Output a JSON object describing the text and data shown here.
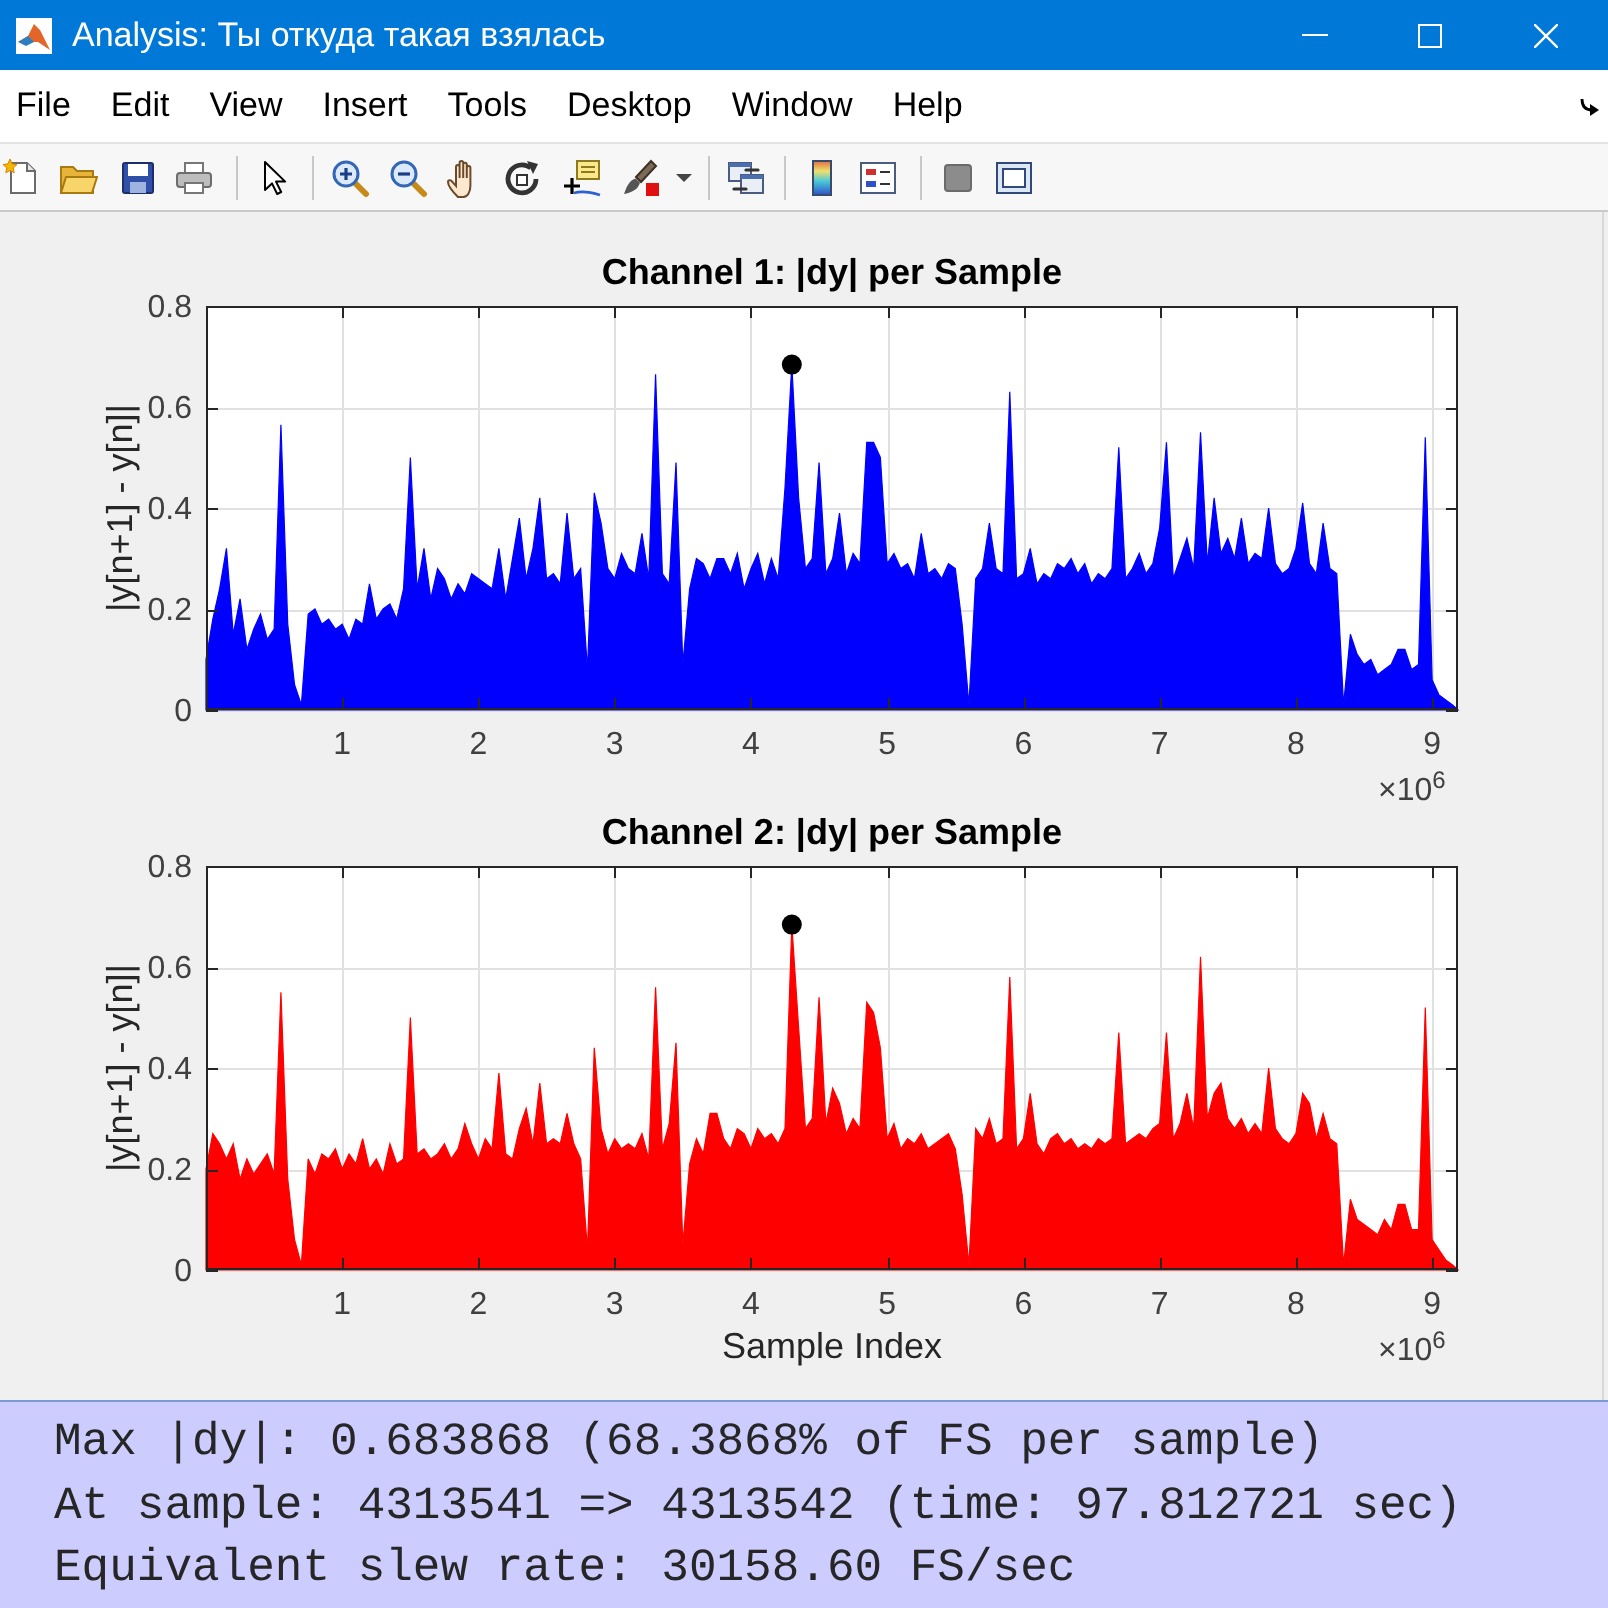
{
  "window": {
    "title": "Analysis: Ты откуда такая взялась"
  },
  "menu": [
    "File",
    "Edit",
    "View",
    "Insert",
    "Tools",
    "Desktop",
    "Window",
    "Help"
  ],
  "figure": {
    "axes": [
      {
        "x_exponent": "×10$^{6}$",
        "peak_marker": true,
        "chart_data": {
          "type": "area",
          "title": "Channel 1: |dy| per Sample",
          "ylabel": "|y[n+1] - y[n]|",
          "grid": true,
          "xlim": [
            0,
            9.19
          ],
          "ylim": [
            0,
            0.8
          ],
          "xticks": [
            1,
            2,
            3,
            4,
            5,
            6,
            7,
            8,
            9
          ],
          "yticks": [
            0,
            0.2,
            0.4,
            0.6,
            0.8
          ],
          "x": [
            0,
            0.05,
            0.1,
            0.15,
            0.2,
            0.25,
            0.3,
            0.35,
            0.4,
            0.45,
            0.5,
            0.55,
            0.6,
            0.65,
            0.7,
            0.75,
            0.8,
            0.85,
            0.9,
            0.95,
            1,
            1.05,
            1.1,
            1.15,
            1.2,
            1.25,
            1.3,
            1.35,
            1.4,
            1.45,
            1.5,
            1.55,
            1.6,
            1.65,
            1.7,
            1.75,
            1.8,
            1.85,
            1.9,
            1.95,
            2,
            2.05,
            2.1,
            2.15,
            2.2,
            2.25,
            2.3,
            2.35,
            2.4,
            2.45,
            2.5,
            2.55,
            2.6,
            2.65,
            2.7,
            2.75,
            2.8,
            2.85,
            2.9,
            2.95,
            3,
            3.05,
            3.1,
            3.15,
            3.2,
            3.25,
            3.3,
            3.35,
            3.4,
            3.45,
            3.5,
            3.55,
            3.6,
            3.65,
            3.7,
            3.75,
            3.8,
            3.85,
            3.9,
            3.95,
            4,
            4.05,
            4.1,
            4.15,
            4.2,
            4.25,
            4.3,
            4.35,
            4.4,
            4.45,
            4.5,
            4.55,
            4.6,
            4.65,
            4.7,
            4.75,
            4.8,
            4.85,
            4.9,
            4.95,
            5,
            5.05,
            5.1,
            5.15,
            5.2,
            5.25,
            5.3,
            5.35,
            5.4,
            5.45,
            5.5,
            5.55,
            5.6,
            5.65,
            5.7,
            5.75,
            5.8,
            5.85,
            5.9,
            5.95,
            6,
            6.05,
            6.1,
            6.15,
            6.2,
            6.25,
            6.3,
            6.35,
            6.4,
            6.45,
            6.5,
            6.55,
            6.6,
            6.65,
            6.7,
            6.75,
            6.8,
            6.85,
            6.9,
            6.95,
            7,
            7.05,
            7.1,
            7.15,
            7.2,
            7.25,
            7.3,
            7.35,
            7.4,
            7.45,
            7.5,
            7.55,
            7.6,
            7.65,
            7.7,
            7.75,
            7.8,
            7.85,
            7.9,
            7.95,
            8,
            8.05,
            8.1,
            8.15,
            8.2,
            8.25,
            8.3,
            8.35,
            8.4,
            8.45,
            8.5,
            8.55,
            8.6,
            8.65,
            8.7,
            8.75,
            8.8,
            8.85,
            8.9,
            8.95,
            9,
            9.05,
            9.1,
            9.15,
            9.19
          ],
          "series": [
            {
              "color": "#0000ff",
              "values": [
                0.1,
                0.18,
                0.24,
                0.32,
                0.15,
                0.22,
                0.12,
                0.16,
                0.19,
                0.14,
                0.16,
                0.565,
                0.17,
                0.05,
                0.01,
                0.19,
                0.2,
                0.17,
                0.18,
                0.16,
                0.17,
                0.14,
                0.18,
                0.17,
                0.25,
                0.18,
                0.2,
                0.21,
                0.18,
                0.24,
                0.5,
                0.24,
                0.32,
                0.22,
                0.28,
                0.26,
                0.22,
                0.25,
                0.23,
                0.27,
                0.26,
                0.25,
                0.24,
                0.32,
                0.22,
                0.3,
                0.38,
                0.26,
                0.32,
                0.42,
                0.26,
                0.27,
                0.25,
                0.39,
                0.26,
                0.28,
                0.08,
                0.43,
                0.37,
                0.28,
                0.26,
                0.31,
                0.28,
                0.27,
                0.35,
                0.26,
                0.665,
                0.27,
                0.25,
                0.49,
                0.09,
                0.24,
                0.3,
                0.29,
                0.26,
                0.3,
                0.3,
                0.27,
                0.31,
                0.24,
                0.28,
                0.31,
                0.25,
                0.3,
                0.26,
                0.44,
                0.684,
                0.42,
                0.28,
                0.3,
                0.49,
                0.27,
                0.3,
                0.39,
                0.27,
                0.31,
                0.29,
                0.53,
                0.53,
                0.5,
                0.29,
                0.31,
                0.28,
                0.29,
                0.26,
                0.35,
                0.27,
                0.28,
                0.26,
                0.29,
                0.28,
                0.17,
                0.01,
                0.26,
                0.28,
                0.37,
                0.28,
                0.27,
                0.63,
                0.26,
                0.27,
                0.32,
                0.25,
                0.27,
                0.26,
                0.29,
                0.28,
                0.3,
                0.27,
                0.29,
                0.25,
                0.27,
                0.26,
                0.28,
                0.52,
                0.26,
                0.28,
                0.31,
                0.27,
                0.29,
                0.36,
                0.53,
                0.26,
                0.3,
                0.34,
                0.28,
                0.55,
                0.29,
                0.42,
                0.31,
                0.34,
                0.3,
                0.38,
                0.29,
                0.31,
                0.3,
                0.4,
                0.29,
                0.27,
                0.28,
                0.32,
                0.41,
                0.29,
                0.27,
                0.37,
                0.28,
                0.27,
                0.01,
                0.15,
                0.11,
                0.09,
                0.1,
                0.07,
                0.08,
                0.09,
                0.12,
                0.12,
                0.08,
                0.09,
                0.54,
                0.06,
                0.03,
                0.02,
                0.01,
                0
              ]
            }
          ]
        }
      },
      {
        "x_exponent": "×10$^{6}$",
        "peak_marker": true,
        "chart_data": {
          "type": "area",
          "title": "Channel 2: |dy| per Sample",
          "xlabel": "Sample Index",
          "ylabel": "|y[n+1] - y[n]|",
          "grid": true,
          "xlim": [
            0,
            9.19
          ],
          "ylim": [
            0,
            0.8
          ],
          "xticks": [
            1,
            2,
            3,
            4,
            5,
            6,
            7,
            8,
            9
          ],
          "yticks": [
            0,
            0.2,
            0.4,
            0.6,
            0.8
          ],
          "x": [
            0,
            0.05,
            0.1,
            0.15,
            0.2,
            0.25,
            0.3,
            0.35,
            0.4,
            0.45,
            0.5,
            0.55,
            0.6,
            0.65,
            0.7,
            0.75,
            0.8,
            0.85,
            0.9,
            0.95,
            1,
            1.05,
            1.1,
            1.15,
            1.2,
            1.25,
            1.3,
            1.35,
            1.4,
            1.45,
            1.5,
            1.55,
            1.6,
            1.65,
            1.7,
            1.75,
            1.8,
            1.85,
            1.9,
            1.95,
            2,
            2.05,
            2.1,
            2.15,
            2.2,
            2.25,
            2.3,
            2.35,
            2.4,
            2.45,
            2.5,
            2.55,
            2.6,
            2.65,
            2.7,
            2.75,
            2.8,
            2.85,
            2.9,
            2.95,
            3,
            3.05,
            3.1,
            3.15,
            3.2,
            3.25,
            3.3,
            3.35,
            3.4,
            3.45,
            3.5,
            3.55,
            3.6,
            3.65,
            3.7,
            3.75,
            3.8,
            3.85,
            3.9,
            3.95,
            4,
            4.05,
            4.1,
            4.15,
            4.2,
            4.25,
            4.3,
            4.35,
            4.4,
            4.45,
            4.5,
            4.55,
            4.6,
            4.65,
            4.7,
            4.75,
            4.8,
            4.85,
            4.9,
            4.95,
            5,
            5.05,
            5.1,
            5.15,
            5.2,
            5.25,
            5.3,
            5.35,
            5.4,
            5.45,
            5.5,
            5.55,
            5.6,
            5.65,
            5.7,
            5.75,
            5.8,
            5.85,
            5.9,
            5.95,
            6,
            6.05,
            6.1,
            6.15,
            6.2,
            6.25,
            6.3,
            6.35,
            6.4,
            6.45,
            6.5,
            6.55,
            6.6,
            6.65,
            6.7,
            6.75,
            6.8,
            6.85,
            6.9,
            6.95,
            7,
            7.05,
            7.1,
            7.15,
            7.2,
            7.25,
            7.3,
            7.35,
            7.4,
            7.45,
            7.5,
            7.55,
            7.6,
            7.65,
            7.7,
            7.75,
            7.8,
            7.85,
            7.9,
            7.95,
            8,
            8.05,
            8.1,
            8.15,
            8.2,
            8.25,
            8.3,
            8.35,
            8.4,
            8.45,
            8.5,
            8.55,
            8.6,
            8.65,
            8.7,
            8.75,
            8.8,
            8.85,
            8.9,
            8.95,
            9,
            9.05,
            9.1,
            9.15,
            9.19
          ],
          "series": [
            {
              "color": "#ff0000",
              "values": [
                0.2,
                0.27,
                0.25,
                0.22,
                0.25,
                0.18,
                0.22,
                0.19,
                0.21,
                0.23,
                0.19,
                0.55,
                0.18,
                0.06,
                0.01,
                0.22,
                0.19,
                0.23,
                0.22,
                0.24,
                0.2,
                0.23,
                0.21,
                0.26,
                0.2,
                0.22,
                0.19,
                0.25,
                0.21,
                0.22,
                0.5,
                0.23,
                0.24,
                0.22,
                0.23,
                0.25,
                0.22,
                0.24,
                0.29,
                0.25,
                0.22,
                0.26,
                0.24,
                0.39,
                0.23,
                0.22,
                0.28,
                0.32,
                0.25,
                0.37,
                0.25,
                0.26,
                0.25,
                0.31,
                0.25,
                0.22,
                0.04,
                0.44,
                0.28,
                0.23,
                0.26,
                0.24,
                0.25,
                0.24,
                0.27,
                0.22,
                0.56,
                0.24,
                0.29,
                0.45,
                0.05,
                0.21,
                0.26,
                0.23,
                0.31,
                0.31,
                0.26,
                0.24,
                0.28,
                0.27,
                0.24,
                0.28,
                0.26,
                0.27,
                0.25,
                0.28,
                0.684,
                0.48,
                0.28,
                0.3,
                0.54,
                0.29,
                0.36,
                0.33,
                0.27,
                0.3,
                0.28,
                0.53,
                0.51,
                0.44,
                0.26,
                0.29,
                0.24,
                0.26,
                0.25,
                0.27,
                0.24,
                0.25,
                0.26,
                0.27,
                0.24,
                0.15,
                0.01,
                0.28,
                0.26,
                0.3,
                0.25,
                0.26,
                0.58,
                0.24,
                0.26,
                0.35,
                0.25,
                0.23,
                0.26,
                0.27,
                0.25,
                0.26,
                0.24,
                0.25,
                0.24,
                0.26,
                0.25,
                0.26,
                0.47,
                0.25,
                0.26,
                0.27,
                0.26,
                0.28,
                0.29,
                0.47,
                0.26,
                0.29,
                0.35,
                0.28,
                0.62,
                0.3,
                0.35,
                0.37,
                0.3,
                0.28,
                0.3,
                0.27,
                0.29,
                0.27,
                0.4,
                0.28,
                0.26,
                0.25,
                0.27,
                0.35,
                0.33,
                0.26,
                0.31,
                0.26,
                0.25,
                0.01,
                0.14,
                0.1,
                0.09,
                0.08,
                0.07,
                0.1,
                0.08,
                0.13,
                0.13,
                0.08,
                0.08,
                0.52,
                0.06,
                0.04,
                0.02,
                0.01,
                0
              ]
            }
          ]
        }
      }
    ]
  },
  "output": {
    "lines": [
      "Max |dy|: 0.683868 (68.3868% of FS per sample)",
      "At sample: 4313541 => 4313542 (time: 97.812721 sec)",
      "Equivalent slew rate: 30158.60 FS/sec"
    ]
  }
}
